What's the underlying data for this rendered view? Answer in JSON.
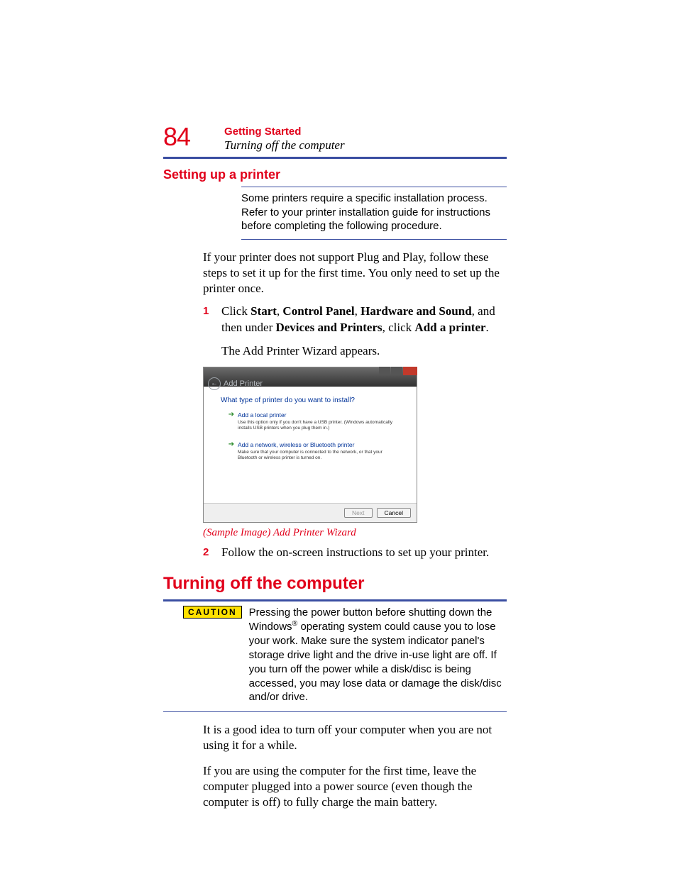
{
  "header": {
    "page_number": "84",
    "chapter": "Getting Started",
    "subtitle": "Turning off the computer"
  },
  "section1": {
    "heading": "Setting up a printer",
    "note": "Some printers require a specific installation process. Refer to your printer installation guide for instructions before completing the following procedure.",
    "intro": "If your printer does not support Plug and Play, follow these steps to set it up for the first time. You only need to set up the printer once.",
    "step1_num": "1",
    "step1_prefix": "Click ",
    "step1_b1": "Start",
    "step1_s1": ", ",
    "step1_b2": "Control Panel",
    "step1_s2": ", ",
    "step1_b3": "Hardware and Sound",
    "step1_s3": ", and then under ",
    "step1_b4": "Devices and Printers",
    "step1_s4": ", click ",
    "step1_b5": "Add a printer",
    "step1_s5": ".",
    "step1_result": "The Add Printer Wizard appears.",
    "caption": "(Sample Image) Add Printer Wizard",
    "step2_num": "2",
    "step2_text": "Follow the on-screen instructions to set up your printer."
  },
  "wizard": {
    "back_label": "Add Printer",
    "question": "What type of printer do you want to install?",
    "opt1_title": "Add a local printer",
    "opt1_desc": "Use this option only if you don't have a USB printer. (Windows automatically installs USB printers when you plug them in.)",
    "opt2_title": "Add a network, wireless or Bluetooth printer",
    "opt2_desc": "Make sure that your computer is connected to the network, or that your Bluetooth or wireless printer is turned on.",
    "next": "Next",
    "cancel": "Cancel"
  },
  "section2": {
    "heading": "Turning off the computer",
    "caution_label": "CAUTION",
    "caution_p1": "Pressing the power button before shutting down the Windows",
    "caution_p2": " operating system could cause you to lose your work. Make sure the system indicator panel's storage drive light and the drive in-use light are off. If you turn off the power while a disk/disc is being accessed, you may lose data or damage the disk/disc and/or drive.",
    "body1": "It is a good idea to turn off your computer when you are not using it for a while.",
    "body2": "If you are using the computer for the first time, leave the computer plugged into a power source (even though the computer is off) to fully charge the main battery."
  }
}
